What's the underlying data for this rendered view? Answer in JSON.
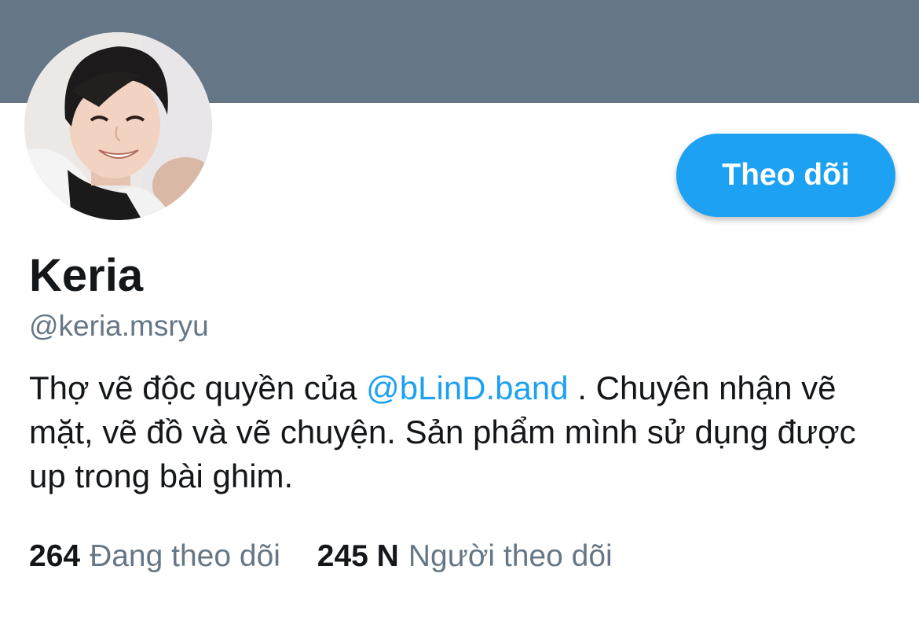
{
  "profile": {
    "banner_color": "#657786",
    "avatar_icon": "profile-photo",
    "follow_button_label": "Theo dõi",
    "name": "Keria",
    "handle": "@keria.msryu",
    "bio": {
      "before_mention": "Thợ vẽ độc quyền của ",
      "mention": "@bLinD.band",
      "after_mention": " . Chuyên nhận vẽ mặt, vẽ đồ và vẽ chuyện. Sản phẩm mình sử dụng được up trong bài ghim."
    },
    "stats": {
      "following_count": "264",
      "following_label": "Đang theo dõi",
      "followers_count": "245 N",
      "followers_label": "Người theo dõi"
    },
    "accent_color": "#1da1f2",
    "secondary_text_color": "#657786"
  }
}
